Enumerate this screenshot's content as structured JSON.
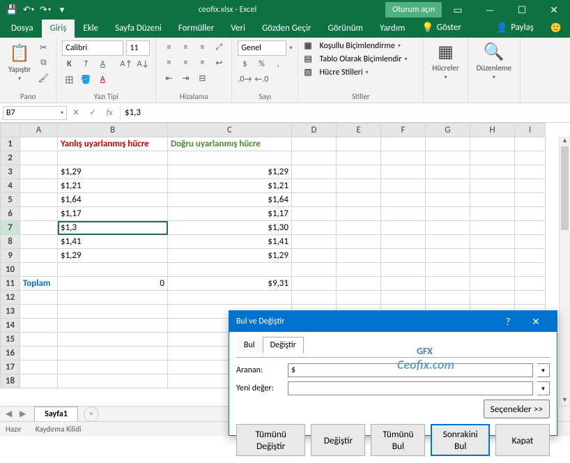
{
  "title": {
    "file": "ceofix.xlsx",
    "app": "Excel",
    "session": "Oturum açın"
  },
  "qat": {
    "save": "💾",
    "undo": "↶",
    "redo": "↷"
  },
  "tabs": {
    "items": [
      "Dosya",
      "Giriş",
      "Ekle",
      "Sayfa Düzeni",
      "Formüller",
      "Veri",
      "Gözden Geçir",
      "Görünüm",
      "Yardım"
    ],
    "tell": "Göster",
    "share": "Paylaş"
  },
  "ribbon": {
    "clipboard": {
      "paste": "Yapıştır",
      "title": "Pano"
    },
    "font": {
      "family": "Calibri",
      "size": "11",
      "title": "Yazı Tipi"
    },
    "align": {
      "title": "Hizalama"
    },
    "number": {
      "format": "Genel",
      "title": "Sayı"
    },
    "styles": {
      "cf": "Koşullu Biçimlendirme",
      "table": "Tablo Olarak Biçimlendir",
      "cell": "Hücre Stilleri",
      "title": "Stiller"
    },
    "cells": {
      "title": "Hücreler"
    },
    "editing": {
      "title": "Düzenleme"
    }
  },
  "namebox": "B7",
  "formula": "$1,3",
  "cols": [
    "",
    "A",
    "B",
    "C",
    "D",
    "E",
    "F",
    "G",
    "H",
    "I"
  ],
  "rows": {
    "r1": {
      "b": "Yanlış uyarlanmış hücre",
      "c": "Doğru uyarlanmış hücre"
    },
    "r3": {
      "b": "$1,29",
      "c": "$1,29"
    },
    "r4": {
      "b": "$1,21",
      "c": "$1,21"
    },
    "r5": {
      "b": "$1,64",
      "c": "$1,64"
    },
    "r6": {
      "b": "$1,17",
      "c": "$1,17"
    },
    "r7": {
      "b": "$1,3",
      "c": "$1,30"
    },
    "r8": {
      "b": "$1,41",
      "c": "$1,41"
    },
    "r9": {
      "b": "$1,29",
      "c": "$1,29"
    },
    "r11": {
      "a": "Toplam",
      "b": "0",
      "c": "$9,31"
    }
  },
  "sheet": {
    "name": "Sayfa1"
  },
  "status": {
    "ready": "Hazır",
    "scroll": "Kaydırma Kilidi"
  },
  "dialog": {
    "title": "Bul ve Değiştir",
    "tab_find": "Bul",
    "tab_replace": "Değiştir",
    "find_label": "Aranan:",
    "find_value": "$",
    "replace_label": "Yeni değer:",
    "replace_value": "",
    "options": "Seçenekler >>",
    "btn_replace_all": "Tümünü Değiştir",
    "btn_replace": "Değiştir",
    "btn_find_all": "Tümünü Bul",
    "btn_find_next": "Sonrakini Bul",
    "btn_close": "Kapat"
  },
  "wm": {
    "gfx": "GFX",
    "text": "Ceofix.com"
  }
}
